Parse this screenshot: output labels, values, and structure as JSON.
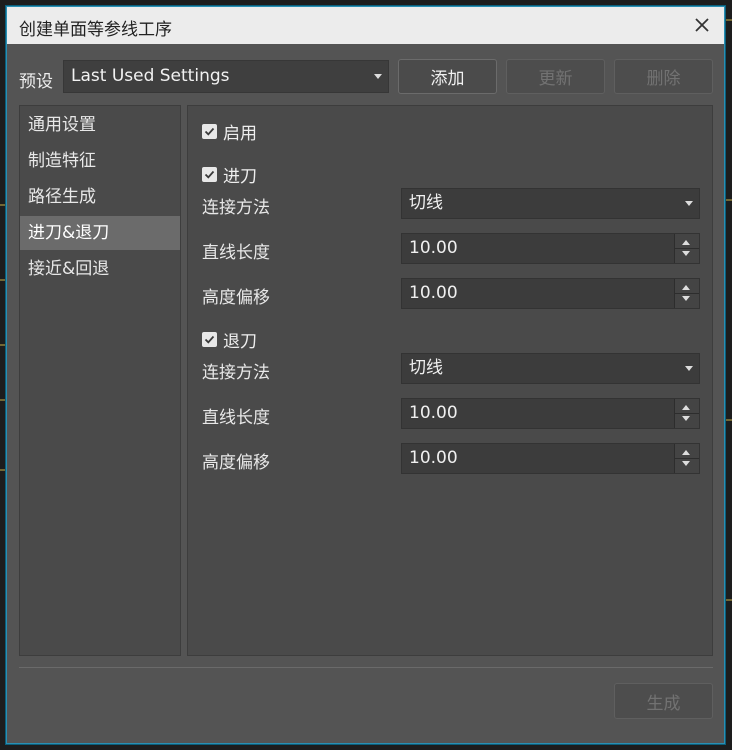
{
  "dialog": {
    "title": "创建单面等参线工序"
  },
  "presets": {
    "label": "预设",
    "selected": "Last Used Settings",
    "add_label": "添加",
    "update_label": "更新",
    "delete_label": "删除"
  },
  "nav": {
    "items": [
      {
        "label": "通用设置"
      },
      {
        "label": "制造特征"
      },
      {
        "label": "路径生成"
      },
      {
        "label": "进刀&退刀"
      },
      {
        "label": "接近&回退"
      }
    ],
    "selected_index": 3
  },
  "settings": {
    "enable": {
      "label": "启用",
      "checked": true
    },
    "lead_in": {
      "label": "进刀",
      "checked": true,
      "connect_label": "连接方法",
      "connect_value": "切线",
      "line_length_label": "直线长度",
      "line_length_value": "10.00",
      "height_offset_label": "高度偏移",
      "height_offset_value": "10.00"
    },
    "lead_out": {
      "label": "退刀",
      "checked": true,
      "connect_label": "连接方法",
      "connect_value": "切线",
      "line_length_label": "直线长度",
      "line_length_value": "10.00",
      "height_offset_label": "高度偏移",
      "height_offset_value": "10.00"
    }
  },
  "footer": {
    "generate_label": "生成"
  },
  "colors": {
    "dialog_bg": "#545454",
    "panel_bg": "#4a4a4a",
    "titlebar_bg": "#ececec",
    "border_accent": "#2a8fb3",
    "selected_nav": "#6b6b6b"
  }
}
